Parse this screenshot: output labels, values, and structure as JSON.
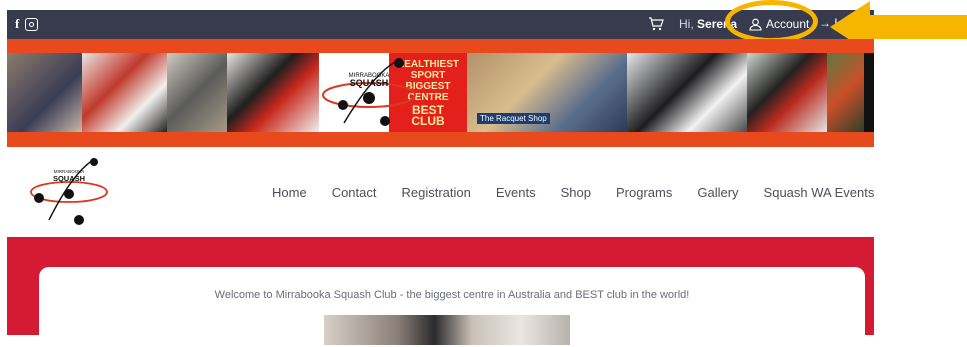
{
  "topbar": {
    "greeting_prefix": "Hi,",
    "user_name": "Serena",
    "account_label": "Account",
    "logout_label": "L",
    "icons": [
      "facebook-icon",
      "instagram-icon",
      "cart-icon",
      "user-icon",
      "arrow-right-icon"
    ]
  },
  "banner": {
    "logo_line1": "MIRRABOOKA",
    "logo_line2": "SQUASH",
    "red_panel": [
      "HEALTHIEST",
      "SPORT",
      "BIGGEST",
      "CENTRE",
      "BEST",
      "CLUB"
    ],
    "shop_sign": "The Racquet Shop"
  },
  "nav": {
    "logo_line1": "MIRRABOOKA",
    "logo_line2": "SQUASH",
    "items": [
      "Home",
      "Contact",
      "Registration",
      "Events",
      "Shop",
      "Programs",
      "Gallery",
      "Squash WA Events"
    ]
  },
  "content": {
    "welcome": "Welcome to Mirrabooka Squash Club  - the biggest centre in Australia and BEST club in the world!"
  },
  "colors": {
    "topbar": "#383b4d",
    "banner": "#e84a1d",
    "section": "#d51a33",
    "highlight": "#f7b500"
  }
}
